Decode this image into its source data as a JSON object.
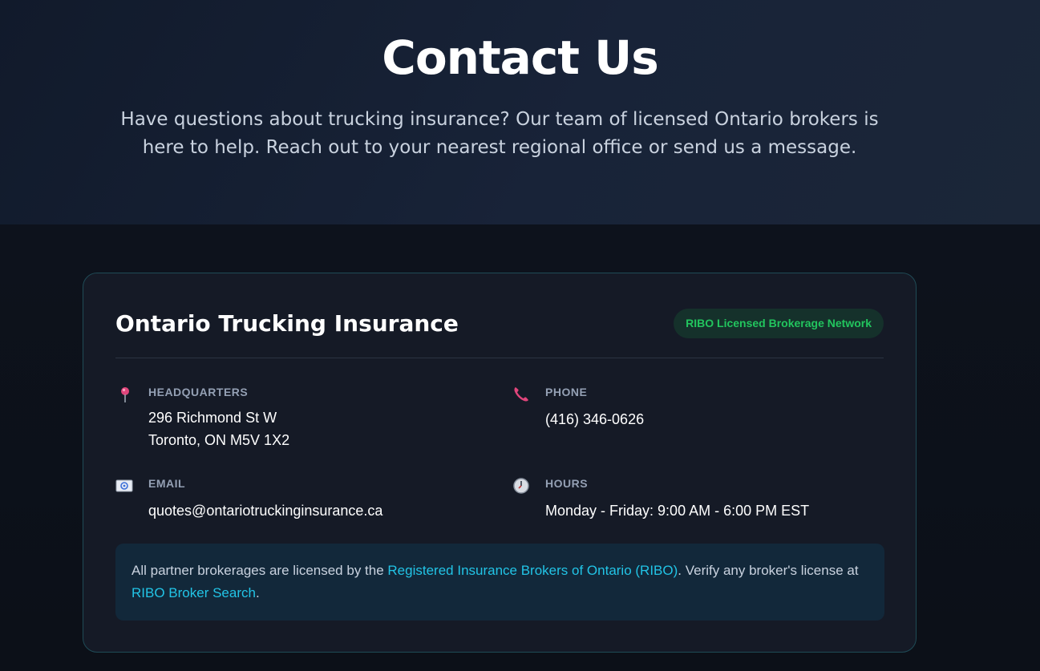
{
  "hero": {
    "title": "Contact Us",
    "subtitle": "Have questions about trucking insurance? Our team of licensed Ontario brokers is here to help. Reach out to your nearest regional office or send us a message."
  },
  "card": {
    "title": "Ontario Trucking Insurance",
    "badge": "RIBO Licensed Brokerage Network",
    "headquarters": {
      "label": "HEADQUARTERS",
      "line1": "296 Richmond St W",
      "line2": "Toronto, ON M5V 1X2",
      "icon": "map-pin-icon"
    },
    "phone": {
      "label": "PHONE",
      "value": "(416) 346-0626",
      "icon": "phone-icon"
    },
    "email": {
      "label": "EMAIL",
      "value": "quotes@ontariotruckinginsurance.ca",
      "icon": "email-icon"
    },
    "hours": {
      "label": "HOURS",
      "value": "Monday - Friday: 9:00 AM - 6:00 PM EST",
      "icon": "clock-icon"
    },
    "note": {
      "text_before": "All partner brokerages are licensed by the ",
      "link1": "Registered Insurance Brokers of Ontario (RIBO)",
      "text_middle": ". Verify any broker's license at ",
      "link2": "RIBO Broker Search",
      "text_after": "."
    }
  },
  "colors": {
    "accent": "#22c4e6",
    "badge_text": "#22c55e",
    "icon_pink": "#e0457b"
  }
}
